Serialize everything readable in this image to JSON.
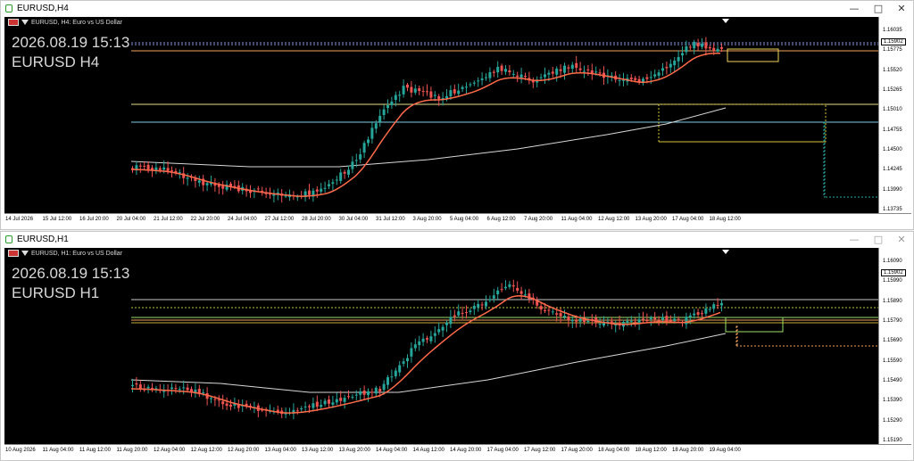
{
  "top": {
    "title": "EURUSD,H4",
    "info": "EURUSD, H4:  Euro vs US Dollar",
    "overlay_time": "2026.08.19 15:13",
    "overlay_symbol": "EURUSD H4",
    "price_label": "1.15902",
    "y_labels": [
      "1.16035",
      "1.15775",
      "1.15520",
      "1.15265",
      "1.15010",
      "1.14755",
      "1.14500",
      "1.14245",
      "1.13990",
      "1.13735"
    ],
    "x_labels": [
      "14 Jul 2026",
      "15 Jul 12:00",
      "16 Jul 20:00",
      "20 Jul 04:00",
      "21 Jul 12:00",
      "22 Jul 20:00",
      "24 Jul 04:00",
      "27 Jul 12:00",
      "28 Jul 20:00",
      "30 Jul 04:00",
      "31 Jul 12:00",
      "3 Aug 20:00",
      "5 Aug 04:00",
      "6 Aug 12:00",
      "7 Aug 20:00",
      "11 Aug 04:00",
      "12 Aug 12:00",
      "13 Aug 20:00",
      "17 Aug 04:00",
      "18 Aug 12:00"
    ]
  },
  "bottom": {
    "title": "EURUSD,H1",
    "info": "EURUSD, H1:  Euro vs US Dollar",
    "overlay_time": "2026.08.19 15:13",
    "overlay_symbol": "EURUSD H1",
    "price_label": "1.15902",
    "y_labels": [
      "1.16090",
      "1.15990",
      "1.15890",
      "1.15790",
      "1.15690",
      "1.15590",
      "1.15490",
      "1.15390",
      "1.15290",
      "1.15190"
    ],
    "x_labels": [
      "10 Aug 2026",
      "11 Aug 04:00",
      "11 Aug 12:00",
      "11 Aug 20:00",
      "12 Aug 04:00",
      "12 Aug 12:00",
      "12 Aug 20:00",
      "13 Aug 04:00",
      "13 Aug 12:00",
      "13 Aug 20:00",
      "14 Aug 04:00",
      "14 Aug 12:00",
      "14 Aug 20:00",
      "17 Aug 04:00",
      "17 Aug 12:00",
      "17 Aug 20:00",
      "18 Aug 04:00",
      "18 Aug 12:00",
      "18 Aug 20:00",
      "19 Aug 04:00"
    ]
  },
  "window_buttons": {
    "minimize": "—",
    "maximize": "□",
    "close": "✕"
  },
  "colors": {
    "bull": "#26a69a",
    "bear": "#ef5350",
    "ma_fast": "#ff6b4a",
    "ma_slow": "#d8d8d8"
  }
}
